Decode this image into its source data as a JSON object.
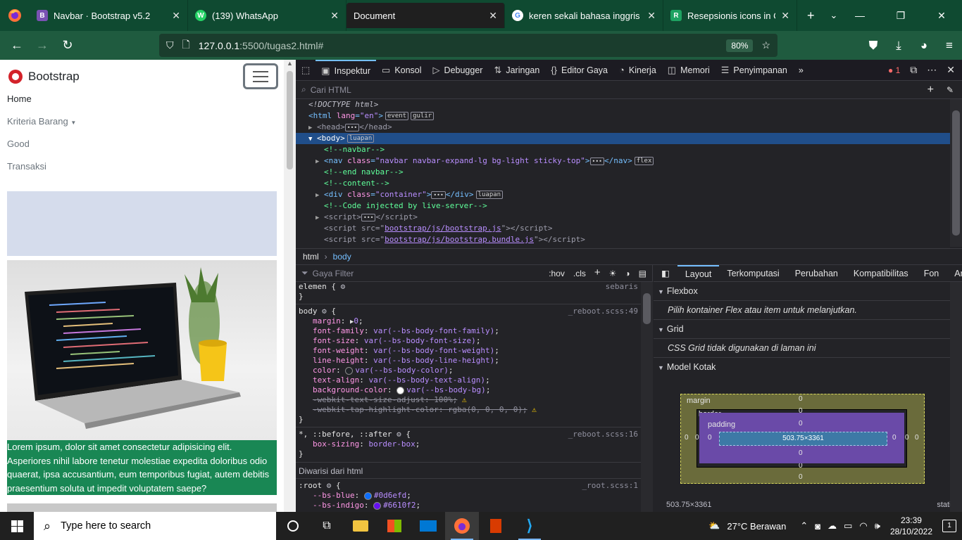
{
  "tabs": [
    {
      "title": "Navbar · Bootstrap v5.2",
      "favicon": "B",
      "favcolor": "#7952b3"
    },
    {
      "title": "(139) WhatsApp",
      "favicon": "W",
      "favcolor": "#25d366"
    },
    {
      "title": "Document",
      "favicon": "",
      "favcolor": ""
    },
    {
      "title": "keren sekali bahasa inggris - G",
      "favicon": "G",
      "favcolor": "#4285f4"
    },
    {
      "title": "Resepsionis icons in Color sty",
      "favicon": "R",
      "favcolor": "#1ea362"
    }
  ],
  "url": {
    "host": "127.0.0.1",
    "path": ":5500/tugas2.html#",
    "zoom": "80%"
  },
  "site": {
    "brand": "Bootstrap",
    "menu": [
      "Home",
      "Kriteria Barang",
      "Good",
      "Transaksi"
    ],
    "caption": "Lorem ipsum, dolor sit amet consectetur adipisicing elit. Asperiores nihil labore tenetur molestiae expedita doloribus odio quaerat, ipsa accusantium, eum temporibus fugiat, autem debitis praesentium soluta ut impedit voluptatem saepe?"
  },
  "devtools": {
    "tabs": [
      "Inspektur",
      "Konsol",
      "Debugger",
      "Jaringan",
      "Editor Gaya",
      "Kinerja",
      "Memori",
      "Penyimpanan"
    ],
    "error_count": "1",
    "search_placeholder": "Cari HTML",
    "markup": {
      "doctype": "<!DOCTYPE html>",
      "html_lang": "\"en\"",
      "badge_event": "event",
      "badge_gulir": "gulir",
      "badge_luapan": "luapan",
      "badge_flex": "flex",
      "c_navbar": "<!--navbar-->",
      "nav_class": "\"navbar navbar-expand-lg bg-light sticky-top\"",
      "c_end_navbar": "<!--end navbar-->",
      "c_content": "<!--content-->",
      "div_class": "\"container\"",
      "c_injected": "<!--Code injected by live-server-->",
      "script1": "bootstrap/js/bootstrap.js",
      "script2": "bootstrap/js/bootstrap.bundle.js"
    },
    "breadcrumb": [
      "html",
      "body"
    ],
    "filter_placeholder": "Gaya Filter",
    "rule_tools": [
      ":hov",
      ".cls"
    ],
    "rules": {
      "elemen_source": "sebaris",
      "body_source": "_reboot.scss:49",
      "body_props": [
        {
          "p": "margin",
          "v": "0"
        },
        {
          "p": "font-family",
          "v": "var(--bs-body-font-family)"
        },
        {
          "p": "font-size",
          "v": "var(--bs-body-font-size)"
        },
        {
          "p": "font-weight",
          "v": "var(--bs-body-font-weight)"
        },
        {
          "p": "line-height",
          "v": "var(--bs-body-line-height)"
        },
        {
          "p": "color",
          "v": "var(--bs-body-color)"
        },
        {
          "p": "text-align",
          "v": "var(--bs-body-text-align)"
        },
        {
          "p": "background-color",
          "v": "var(--bs-body-bg)"
        },
        {
          "p": "-webkit-text-size-adjust",
          "v": "100%"
        },
        {
          "p": "-webkit-tap-highlight-color",
          "v": "rgba(0, 0, 0, 0)"
        }
      ],
      "star_selector": "*, ::before, ::after",
      "star_source": "_reboot.scss:16",
      "star_prop": {
        "p": "box-sizing",
        "v": "border-box"
      },
      "inherited_label": "Diwarisi dari html",
      "root_source": "_root.scss:1",
      "root_props": [
        {
          "p": "--bs-blue",
          "v": "#0d6efd",
          "color": "#0d6efd"
        },
        {
          "p": "--bs-indigo",
          "v": "#6610f2",
          "color": "#6610f2"
        }
      ]
    },
    "side_tabs": [
      "Layout",
      "Terkomputasi",
      "Perubahan",
      "Kompatibilitas",
      "Fon",
      "An"
    ],
    "flexbox": {
      "title": "Flexbox",
      "msg": "Pilih kontainer Flex atau item untuk melanjutkan."
    },
    "grid": {
      "title": "Grid",
      "msg": "CSS Grid tidak digunakan di laman ini"
    },
    "boxmodel": {
      "title": "Model Kotak",
      "margin_label": "margin",
      "border_label": "border",
      "padding_label": "padding",
      "content": "503.75×3361",
      "zero": "0",
      "footer_size": "503.75×3361",
      "footer_position": "static"
    }
  },
  "taskbar": {
    "search_placeholder": "Type here to search",
    "weather": "27°C  Berawan",
    "time": "23:39",
    "date": "28/10/2022"
  }
}
